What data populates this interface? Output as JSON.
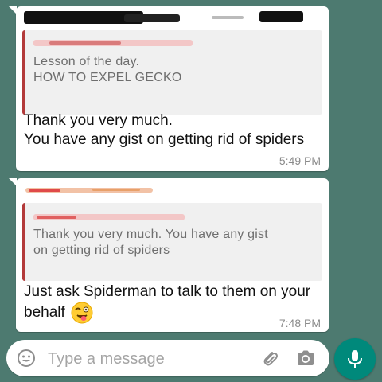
{
  "colors": {
    "background": "#4d7a70",
    "bubble": "#ffffff",
    "quote_bar": "#b33a3a",
    "mic_button": "#00897b"
  },
  "messages": [
    {
      "quoted_text": "Lesson of the day.\nHOW TO EXPEL GECKO",
      "body": "Thank you very much.\nYou have any gist on getting rid of spiders",
      "time": "5:49 PM"
    },
    {
      "quoted_text": "Thank you very much.\nYou have any gist on getting rid of spiders",
      "body": "Just ask Spiderman  to talk to them on your behalf",
      "time": "7:48 PM",
      "emoji": "winking-face-with-tongue-icon"
    }
  ],
  "composer": {
    "placeholder": "Type a message",
    "icons": [
      "emoji-icon",
      "paperclip-icon",
      "camera-icon",
      "microphone-icon"
    ]
  }
}
